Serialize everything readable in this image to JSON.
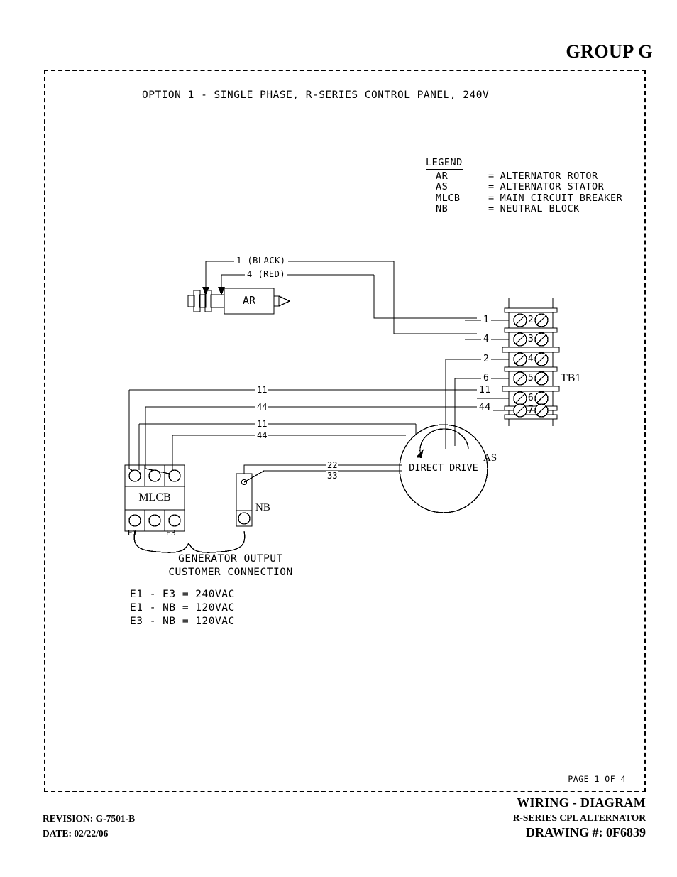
{
  "sheet": {
    "group_label": "GROUP G",
    "diagram_title": "OPTION 1 - SINGLE PHASE, R-SERIES CONTROL PANEL, 240V",
    "page_of": "PAGE 1 OF 4"
  },
  "legend": {
    "heading": "LEGEND",
    "entries": [
      {
        "abbr": "AR",
        "eq": "=",
        "meaning": "ALTERNATOR ROTOR"
      },
      {
        "abbr": "AS",
        "eq": "=",
        "meaning": "ALTERNATOR STATOR"
      },
      {
        "abbr": "MLCB",
        "eq": "=",
        "meaning": "MAIN CIRCUIT BREAKER"
      },
      {
        "abbr": "NB",
        "eq": "=",
        "meaning": "NEUTRAL BLOCK"
      }
    ]
  },
  "components": {
    "ar": {
      "label": "AR"
    },
    "as": {
      "label": "AS",
      "inner_text": "DIRECT DRIVE"
    },
    "mlcb": {
      "label": "MLCB",
      "left_terminal": "E1",
      "right_terminal": "E3"
    },
    "nb": {
      "label": "NB"
    },
    "tb1": {
      "label": "TB1",
      "terminals": [
        "2",
        "3",
        "4",
        "5",
        "6",
        "7"
      ]
    }
  },
  "wires": {
    "rotor_black": "1 (BLACK)",
    "rotor_red": "4 (RED)",
    "tb_left_labels": [
      "1",
      "4",
      "2",
      "6",
      "11",
      "44"
    ],
    "bus_11_upper": "11",
    "bus_44_upper": "44",
    "bus_11_lower": "11",
    "bus_44_lower": "44",
    "tb_11": "11",
    "tb_44": "44",
    "stator_22": "22",
    "stator_33": "33"
  },
  "notes": {
    "connection_line1": "GENERATOR OUTPUT",
    "connection_line2": "CUSTOMER CONNECTION",
    "voltages": [
      "E1 - E3 = 240VAC",
      "E1 - NB = 120VAC",
      "E3 - NB = 120VAC"
    ]
  },
  "titleblock": {
    "line1": "WIRING - DIAGRAM",
    "line2": "R-SERIES CPL ALTERNATOR",
    "line3": "DRAWING #: 0F6839"
  },
  "revision": {
    "revision": "REVISION: G-7501-B",
    "date": "DATE: 02/22/06"
  }
}
